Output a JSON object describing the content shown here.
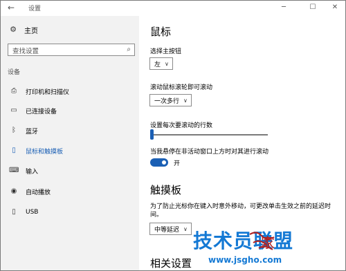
{
  "window": {
    "title": "设置",
    "back_glyph": "←",
    "min_glyph": "─",
    "max_glyph": "☐",
    "close_glyph": "✕"
  },
  "sidebar": {
    "home_label": "主页",
    "search_placeholder": "查找设置",
    "section_label": "设备",
    "items": [
      {
        "label": "打印机和扫描仪",
        "icon": "printer-icon"
      },
      {
        "label": "已连接设备",
        "icon": "connected-devices-icon"
      },
      {
        "label": "蓝牙",
        "icon": "bluetooth-icon"
      },
      {
        "label": "鼠标和触摸板",
        "icon": "mouse-icon",
        "active": true
      },
      {
        "label": "输入",
        "icon": "keyboard-icon"
      },
      {
        "label": "自动播放",
        "icon": "autoplay-icon"
      },
      {
        "label": "USB",
        "icon": "usb-icon"
      }
    ]
  },
  "main": {
    "mouse_heading": "鼠标",
    "primary_button_label": "选择主按钮",
    "primary_button_value": "左",
    "wheel_scroll_label": "滚动鼠标滚轮即可滚动",
    "wheel_scroll_value": "一次多行",
    "lines_label": "设置每次要滚动的行数",
    "lines_slider_fraction": 0.0,
    "inactive_scroll_label": "当我悬停在非活动窗口上方时对其进行滚动",
    "inactive_scroll_state": "开",
    "touchpad_heading": "触摸板",
    "touchpad_desc": "为了防止光标你在键入时意外移动，可更改单击生效之前的延迟时间。",
    "touchpad_delay_value": "中等延迟",
    "related_heading": "相关设置"
  },
  "watermark": {
    "big_text": "技术员联盟",
    "brand_text": "家",
    "url_text": "www.jsgho.com"
  },
  "colors": {
    "accent": "#1a5fb4",
    "sidebar_bg": "#f2f2f2",
    "watermark_blue": "#1479d4",
    "watermark_red": "#b02020"
  }
}
